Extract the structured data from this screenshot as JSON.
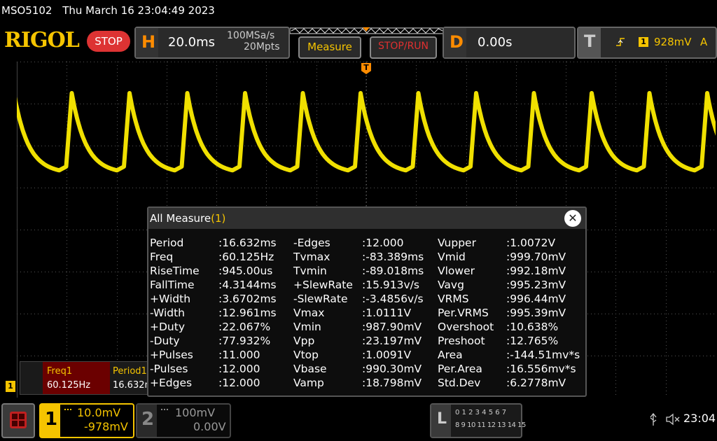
{
  "header": {
    "model": "MSO5102",
    "datetime": "Thu March 16 23:04:49 2023"
  },
  "toolbar": {
    "brand": "RIGOL",
    "stop_label": "STOP",
    "h_letter": "H",
    "timebase": "20.0ms",
    "sample_rate": "100MSa/s",
    "memory_depth": "20Mpts",
    "measure_label": "Measure",
    "stoprun_label": "STOP/RUN",
    "d_letter": "D",
    "delay": "0.00s",
    "t_letter": "T",
    "trigger_channel": "1",
    "trigger_level": "928mV",
    "trigger_mode": "A"
  },
  "measure": {
    "title": "All Measure",
    "title_count": "(1)",
    "col1": [
      [
        "Period",
        ":16.632ms"
      ],
      [
        "Freq",
        ":60.125Hz"
      ],
      [
        "RiseTime",
        ":945.00us"
      ],
      [
        "FallTime",
        ":4.3144ms"
      ],
      [
        "+Width",
        ":3.6702ms"
      ],
      [
        "-Width",
        ":12.961ms"
      ],
      [
        "+Duty",
        ":22.067%"
      ],
      [
        "-Duty",
        ":77.932%"
      ],
      [
        "+Pulses",
        ":11.000"
      ],
      [
        "-Pulses",
        ":12.000"
      ],
      [
        "+Edges",
        ":12.000"
      ]
    ],
    "col2": [
      [
        "-Edges",
        ":12.000"
      ],
      [
        "Tvmax",
        ":-83.389ms"
      ],
      [
        "Tvmin",
        ":-89.018ms"
      ],
      [
        "+SlewRate",
        ":15.913v/s"
      ],
      [
        "-SlewRate",
        ":-3.4856v/s"
      ],
      [
        "Vmax",
        ":1.0111V"
      ],
      [
        "Vmin",
        ":987.90mV"
      ],
      [
        "Vpp",
        ":23.197mV"
      ],
      [
        "Vtop",
        ":1.0091V"
      ],
      [
        "Vbase",
        ":990.30mV"
      ],
      [
        "Vamp",
        ":18.798mV"
      ]
    ],
    "col3": [
      [
        "Vupper",
        ":1.0072V"
      ],
      [
        "Vmid",
        ":999.70mV"
      ],
      [
        "Vlower",
        ":992.18mV"
      ],
      [
        "Vavg",
        ":995.23mV"
      ],
      [
        "VRMS",
        ":996.44mV"
      ],
      [
        "Per.VRMS",
        ":995.39mV"
      ],
      [
        "Overshoot",
        ":10.638%"
      ],
      [
        "Preshoot",
        ":12.765%"
      ],
      [
        "Area",
        ":-144.51mv*s"
      ],
      [
        "Per.Area",
        ":16.556mv*s"
      ],
      [
        "Std.Dev",
        ":6.2778mV"
      ]
    ]
  },
  "quick_meas": {
    "freq_label": "Freq1",
    "freq_value": "60.125Hz",
    "period_label": "Period1",
    "period_value": "16.632m"
  },
  "channel_marker": "1",
  "trigger_marker": "T",
  "bottom": {
    "ch1_number": "1",
    "ch1_scale": "10.0mV",
    "ch1_offset": "-978mV",
    "ch2_number": "2",
    "ch2_scale": "100mV",
    "ch2_offset": "0.00V",
    "l_letter": "L",
    "logic_row1": "0 1 2 3  4 5 6 7",
    "logic_row2": "8 9 10 11 12 13 14 15",
    "clock": "23:04"
  },
  "colors": {
    "trace": "#f0e000",
    "accent": "#ff8c00",
    "stop_red": "#d33333"
  }
}
